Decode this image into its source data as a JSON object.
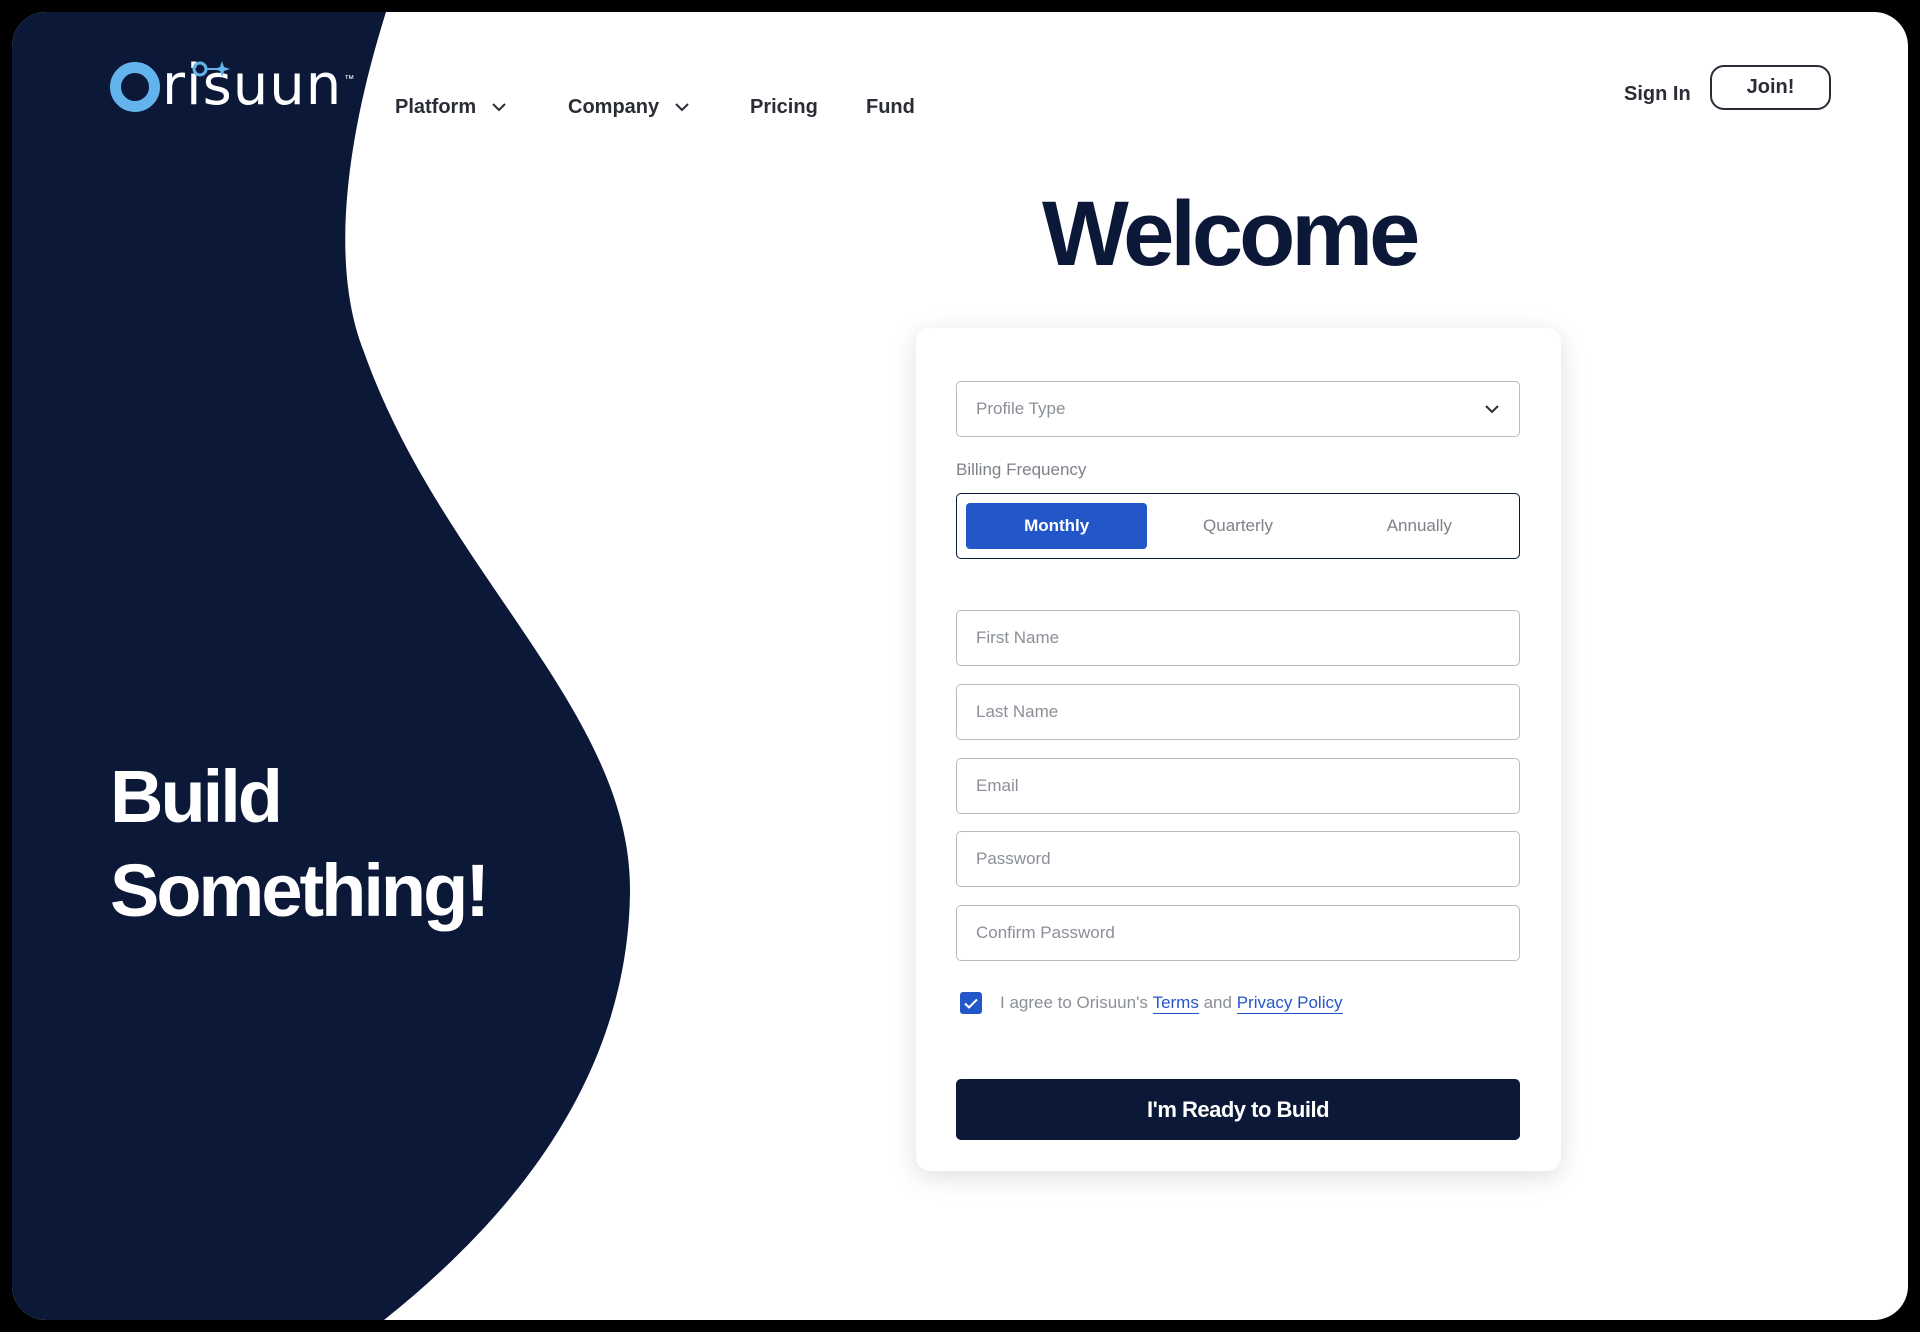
{
  "brand": {
    "name": "risuun",
    "trademark": "™"
  },
  "nav": {
    "items": [
      {
        "label": "Platform",
        "has_dropdown": true
      },
      {
        "label": "Company",
        "has_dropdown": true
      },
      {
        "label": "Pricing",
        "has_dropdown": false
      },
      {
        "label": "Fund",
        "has_dropdown": false
      }
    ],
    "sign_in": "Sign In",
    "join": "Join!"
  },
  "hero": {
    "line1": "Build",
    "line2": "Something!"
  },
  "form": {
    "title": "Welcome",
    "profile_type": {
      "placeholder": "Profile Type"
    },
    "billing": {
      "label": "Billing Frequency",
      "options": [
        "Monthly",
        "Quarterly",
        "Annually"
      ],
      "selected": "Monthly"
    },
    "fields": {
      "first_name": "First Name",
      "last_name": "Last Name",
      "email": "Email",
      "password": "Password",
      "confirm_password": "Confirm Password"
    },
    "agree": {
      "checked": true,
      "prefix": "I agree to Orisuun's",
      "terms": "Terms",
      "and": "and",
      "privacy": "Privacy Policy"
    },
    "submit": "I'm Ready to Build"
  },
  "colors": {
    "navy": "#0b1838",
    "accent_blue": "#2356c8",
    "logo_blue": "#63b3ec",
    "text_dark": "#2a2d36"
  }
}
